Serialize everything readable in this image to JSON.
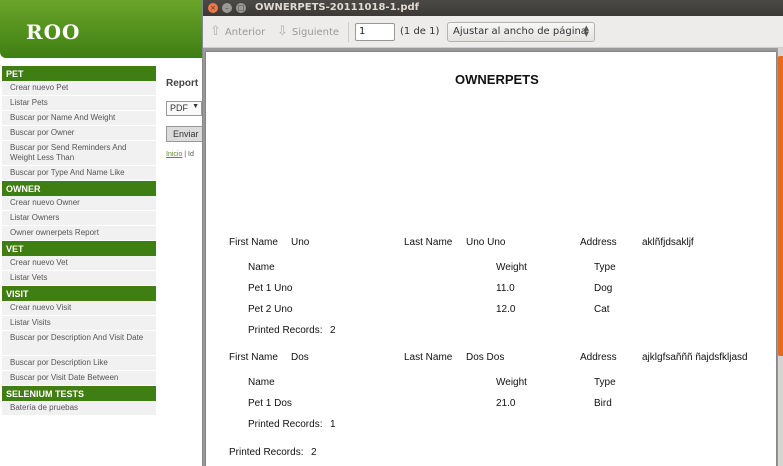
{
  "app": {
    "logo": "ROO",
    "sidebar": [
      {
        "heading": "PET",
        "items": [
          "Crear nuevo Pet",
          "Listar Pets",
          "Buscar por Name And Weight",
          "Buscar por Owner",
          "Buscar por Send Reminders And Weight Less Than",
          "Buscar por Type And Name Like"
        ]
      },
      {
        "heading": "OWNER",
        "items": [
          "Crear nuevo Owner",
          "Listar Owners",
          "Owner ownerpets Report"
        ]
      },
      {
        "heading": "VET",
        "items": [
          "Crear nuevo Vet",
          "Listar Vets"
        ]
      },
      {
        "heading": "VISIT",
        "items": [
          "Crear nuevo Visit",
          "Listar Visits",
          "Buscar por Description And Visit Date",
          "Buscar por Description Like",
          "Buscar por Visit Date Between"
        ]
      },
      {
        "heading": "SELENIUM TESTS",
        "items": [
          "Batería de pruebas"
        ]
      }
    ],
    "main": {
      "report_label": "Report",
      "format_value": "PDF",
      "send_label": "Enviar",
      "breadcrumb_link": "Inicio",
      "breadcrumb_rest": "| Id"
    }
  },
  "viewer": {
    "window_title": "OWNERPETS-20111018-1.pdf",
    "toolbar": {
      "prev_label": "Anterior",
      "next_label": "Siguiente",
      "page_value": "1",
      "page_count": "(1 de 1)",
      "zoom_value": "Ajustar al ancho de página"
    },
    "document": {
      "title": "OWNERPETS",
      "first_name_label": "First Name",
      "last_name_label": "Last Name",
      "address_label": "Address",
      "name_col": "Name",
      "weight_col": "Weight",
      "type_col": "Type",
      "printed_label": "Printed Records:",
      "owners": [
        {
          "first_name": "Uno",
          "last_name": "Uno Uno",
          "address": "aklñfjdsakljf",
          "pets": [
            {
              "name": "Pet 1 Uno",
              "weight": "11.0",
              "type": "Dog"
            },
            {
              "name": "Pet 2 Uno",
              "weight": "12.0",
              "type": "Cat"
            }
          ],
          "printed": "2"
        },
        {
          "first_name": "Dos",
          "last_name": "Dos Dos",
          "address": "ajklgfsañññ ñajdsfkljasd",
          "pets": [
            {
              "name": "Pet 1 Dos",
              "weight": "21.0",
              "type": "Bird"
            }
          ],
          "printed": "1"
        }
      ],
      "total_printed": "2"
    }
  },
  "colors": {
    "header_green": "#3f7e12",
    "accent_orange": "#e5691f",
    "titlebar": "#3b3a37"
  }
}
